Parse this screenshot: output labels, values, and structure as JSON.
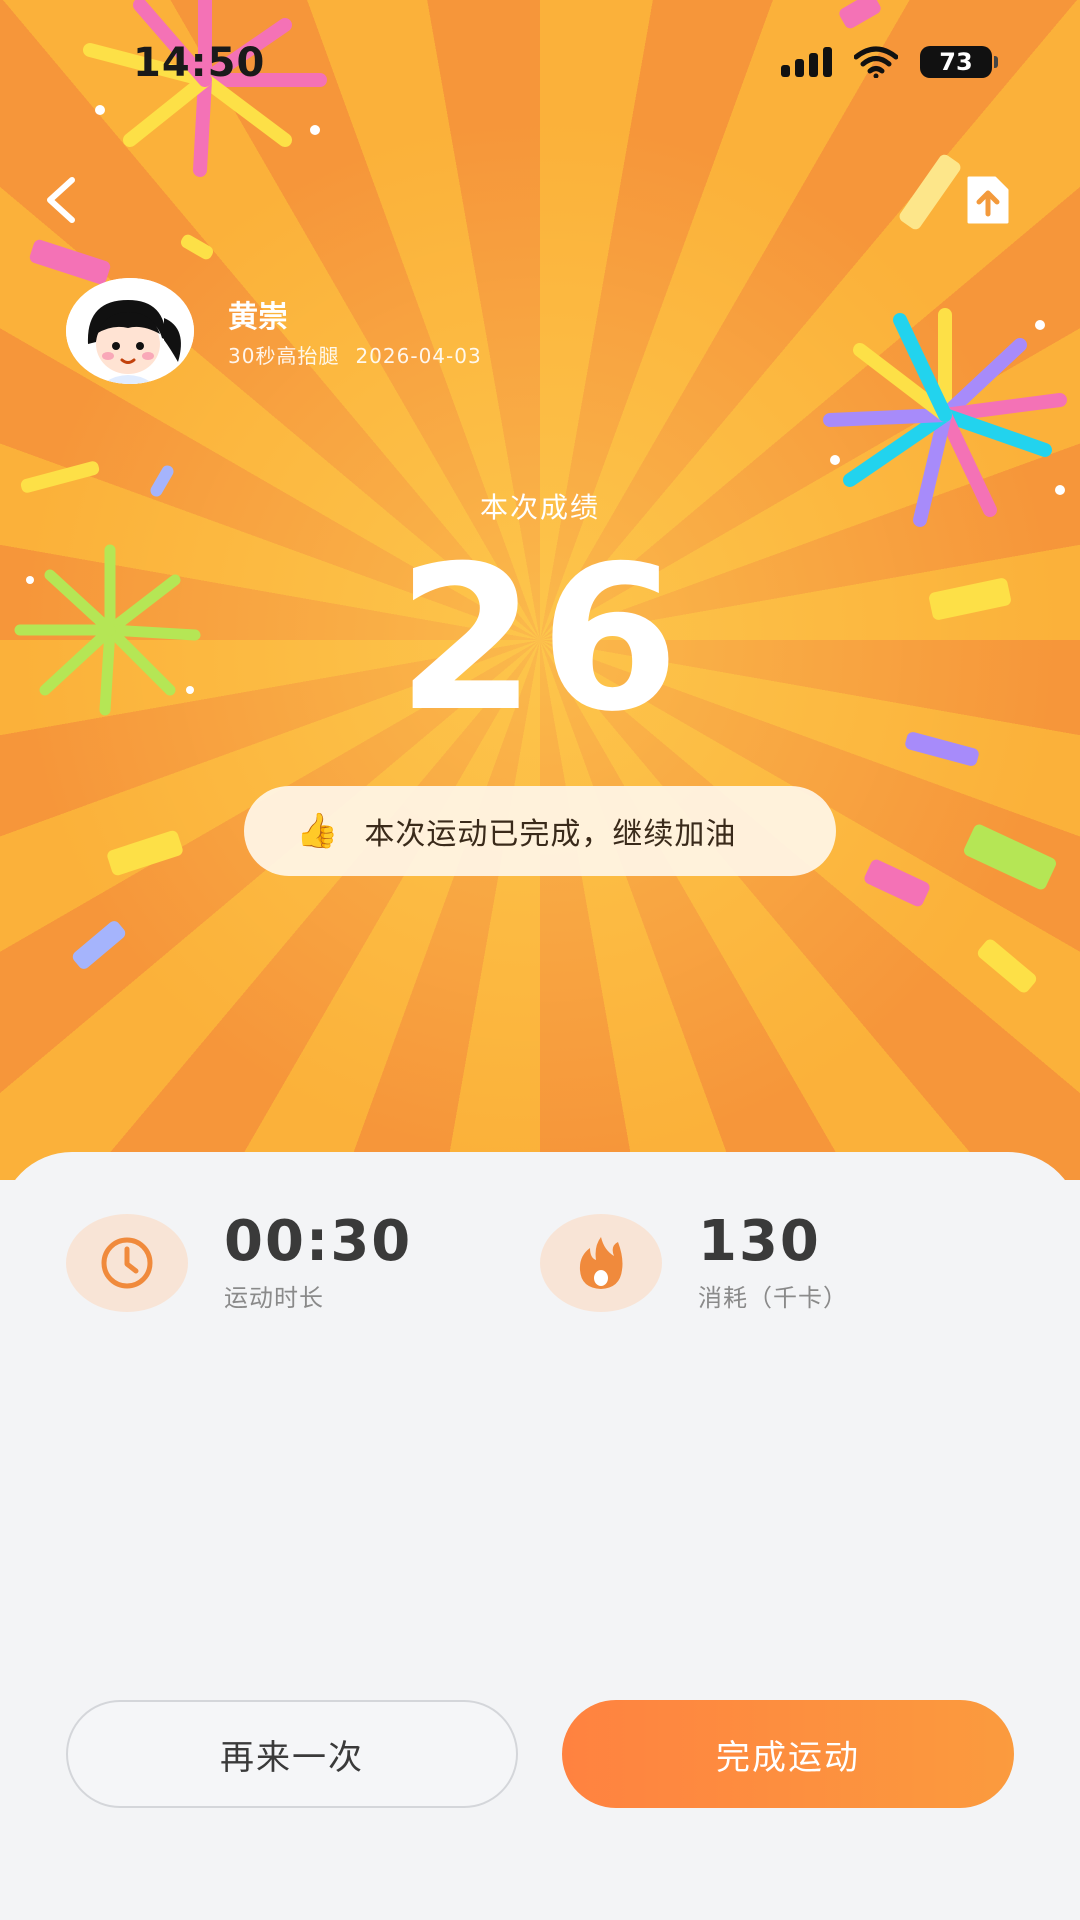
{
  "status_bar": {
    "time": "14:50",
    "battery": "73",
    "icons": [
      "signal-icon",
      "wifi-icon",
      "battery-icon"
    ]
  },
  "nav": {
    "back_icon": "back-arrow-icon",
    "share_icon": "share-upload-icon"
  },
  "user": {
    "name": "黄崇",
    "exercise": "30秒高抬腿",
    "date": "2026-04-03"
  },
  "result": {
    "label": "本次成绩",
    "score": "26",
    "message_icon": "👍",
    "message": "本次运动已完成，继续加油"
  },
  "stats": [
    {
      "icon": "clock-icon",
      "value": "00:30",
      "label": "运动时长"
    },
    {
      "icon": "flame-icon",
      "value": "130",
      "label": "消耗（千卡）"
    }
  ],
  "buttons": {
    "again": "再来一次",
    "finish": "完成运动"
  },
  "colors": {
    "accent": "#ff8240",
    "hero_light": "#fbb13a",
    "hero_dark": "#f6963a",
    "stat_icon_bg": "#f8e4d6",
    "stat_icon": "#f08a3c"
  }
}
